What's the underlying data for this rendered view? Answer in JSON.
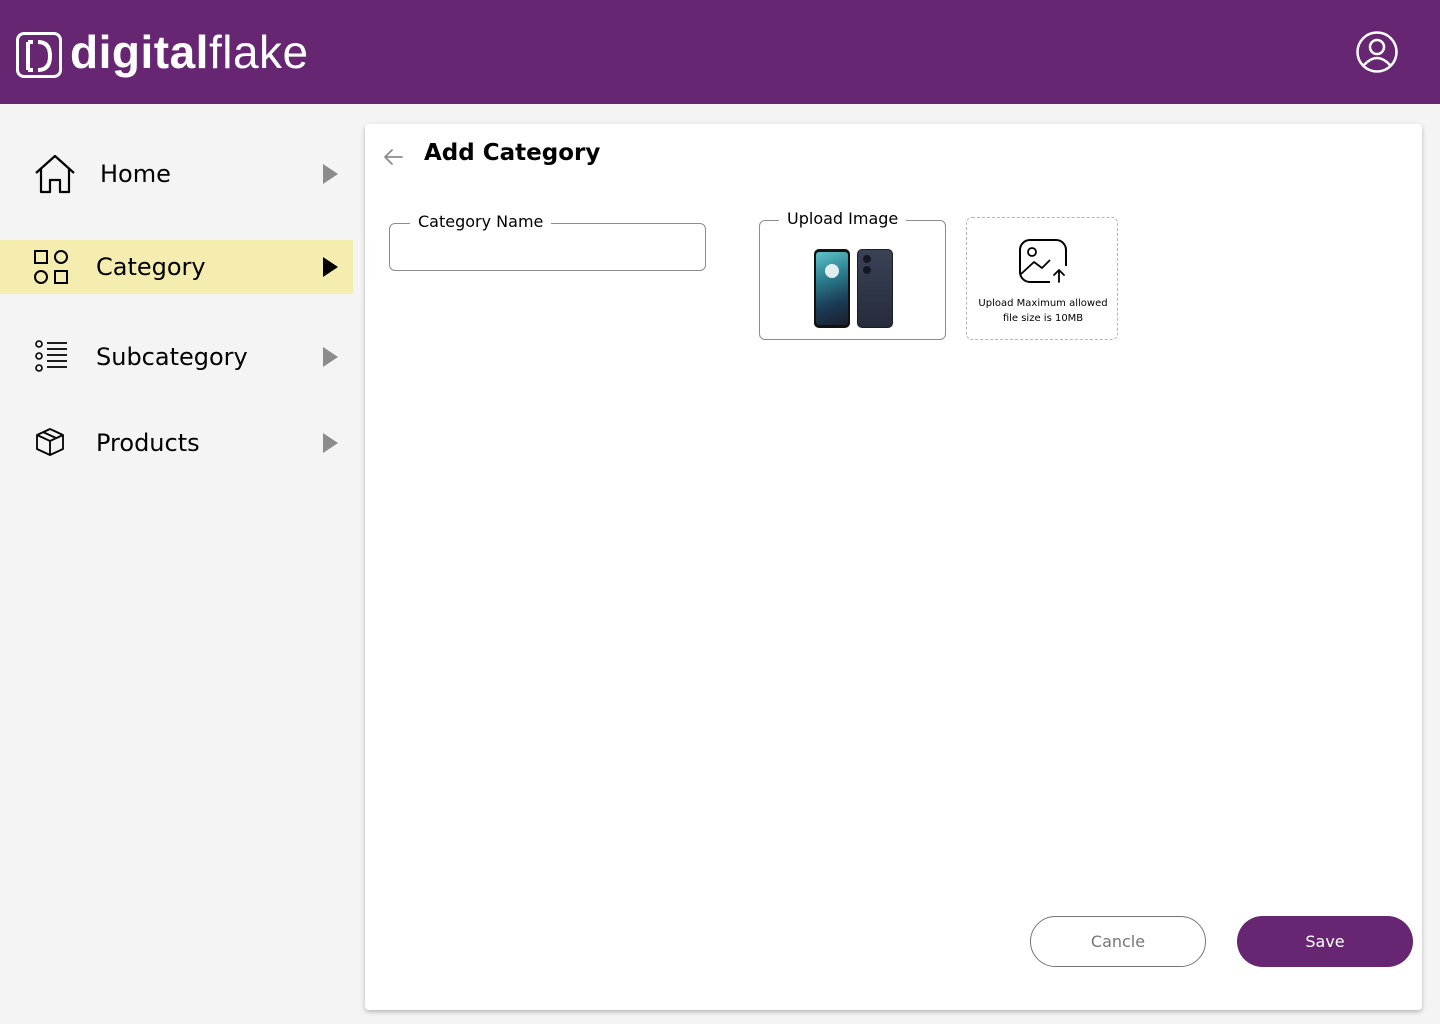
{
  "header": {
    "brand_bold": "digital",
    "brand_light": "flake",
    "brand_color": "#662671"
  },
  "sidebar": {
    "items": [
      {
        "label": "Home",
        "icon": "home-icon",
        "active": false
      },
      {
        "label": "Category",
        "icon": "category-grid-icon",
        "active": true
      },
      {
        "label": "Subcategory",
        "icon": "list-icon",
        "active": false
      },
      {
        "label": "Products",
        "icon": "box-icon",
        "active": false
      }
    ],
    "active_color": "#f4edaf"
  },
  "main": {
    "title": "Add Category",
    "category_name": {
      "label": "Category Name",
      "value": ""
    },
    "upload_image": {
      "label": "Upload Image"
    },
    "dropzone": {
      "line1": "Upload Maximum allowed",
      "line2": "file size is 10MB"
    },
    "cancel_label": "Cancle",
    "save_label": "Save"
  }
}
